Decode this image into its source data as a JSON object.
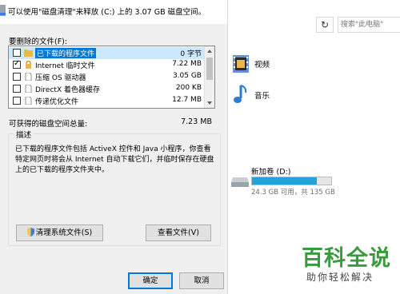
{
  "dialog": {
    "header_text": "可以使用\"磁盘清理\"来释放 (C:) 上的 3.07 GB 磁盘空间。",
    "files_label": "要删除的文件(F):",
    "files": [
      {
        "name": "已下载的程序文件",
        "size": "0 字节",
        "checked": false,
        "selected": true
      },
      {
        "name": "Internet 临时文件",
        "size": "7.22 MB",
        "checked": true,
        "selected": false
      },
      {
        "name": "压缩 OS 驱动器",
        "size": "3.05 GB",
        "checked": false,
        "selected": false
      },
      {
        "name": "DirectX 着色器缓存",
        "size": "200 KB",
        "checked": false,
        "selected": false
      },
      {
        "name": "传递优化文件",
        "size": "12.7 MB",
        "checked": false,
        "selected": false
      }
    ],
    "total_label": "可获得的磁盘空间总量:",
    "total_value": "7.23 MB",
    "description_title": "描述",
    "description_text": "已下载的程序文件包括 ActiveX 控件和 Java 小程序，你查看特定网页时将会从 Internet 自动下载它们，并临时保存在硬盘上的已下载的程序文件夹中。",
    "cleanup_button": "清理系统文件(S)",
    "view_files_button": "查看文件(V)",
    "ok_button": "确定",
    "cancel_button": "取消"
  },
  "explorer": {
    "search_placeholder": "搜索\"此电脑\"",
    "folders": [
      {
        "label": "视频",
        "icon": "video-folder-icon"
      },
      {
        "label": "音乐",
        "icon": "music-folder-icon"
      }
    ],
    "drive_d": {
      "label": "新加卷 (D:)",
      "space_text": "24.3 GB 可用，共 135 GB",
      "used_fraction": 0.82
    }
  },
  "watermark": {
    "main": "百科全说",
    "sub": "助你轻松解决"
  },
  "colors": {
    "accent": "#0078d7",
    "drive_bar": "#26a0da",
    "watermark_green": "#3a9a3e",
    "selection": "#cce8ff"
  }
}
